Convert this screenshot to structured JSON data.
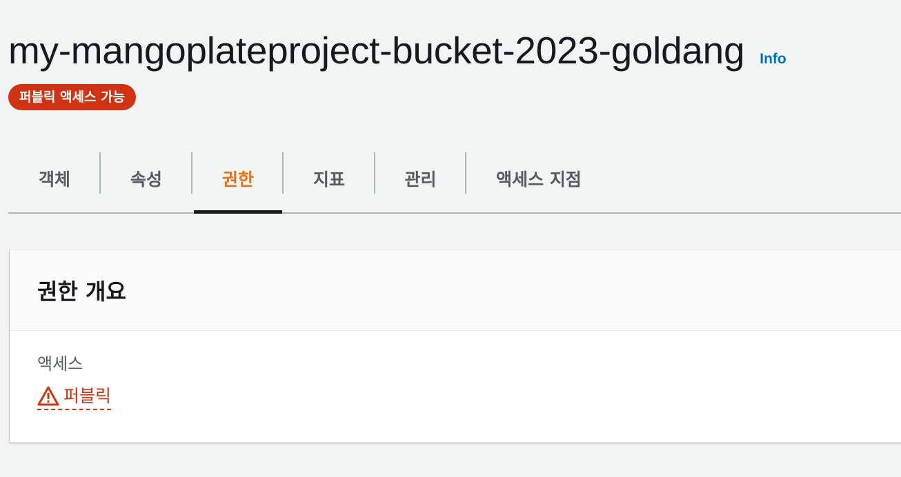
{
  "header": {
    "title": "my-mangoplateproject-bucket-2023-goldang",
    "info_label": "Info",
    "badge": "퍼블릭 액세스 가능"
  },
  "tabs": [
    {
      "label": "객체",
      "active": false
    },
    {
      "label": "속성",
      "active": false
    },
    {
      "label": "권한",
      "active": true
    },
    {
      "label": "지표",
      "active": false
    },
    {
      "label": "관리",
      "active": false
    },
    {
      "label": "액세스 지점",
      "active": false
    }
  ],
  "permissions_overview": {
    "title": "권한 개요",
    "access_label": "액세스",
    "access_value": "퍼블릭",
    "access_icon": "warning-icon"
  },
  "colors": {
    "accent": "#ec7211",
    "danger": "#d13212",
    "link": "#0073bb",
    "text": "#16191f",
    "muted": "#545b64"
  }
}
